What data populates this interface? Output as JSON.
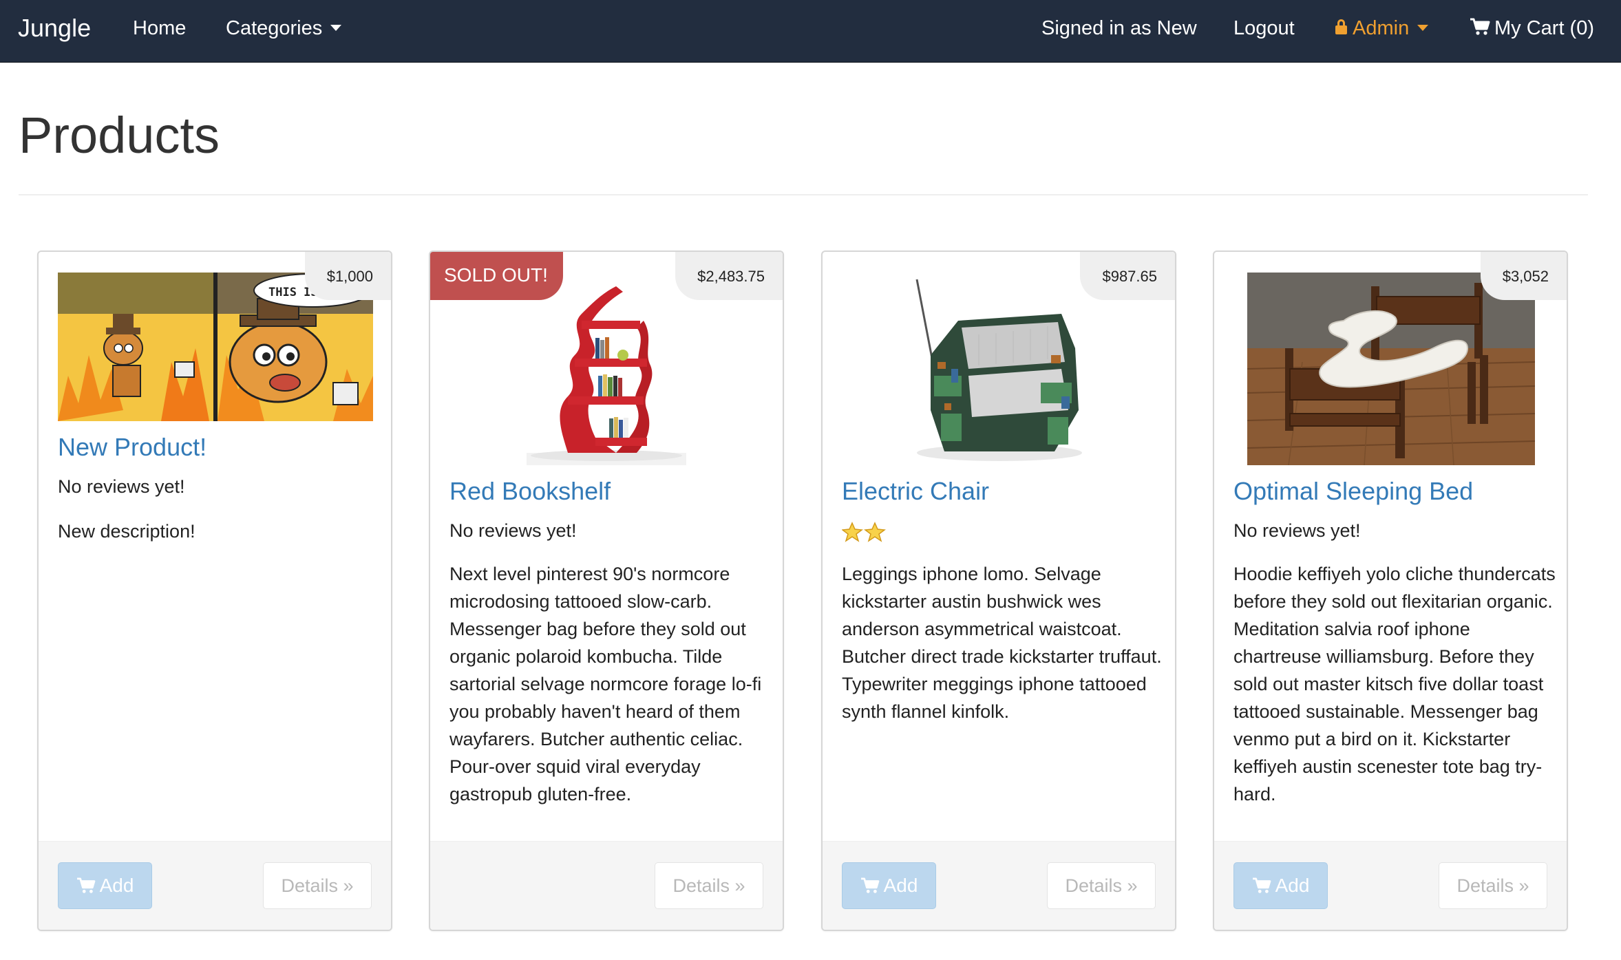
{
  "navbar": {
    "brand": "Jungle",
    "home": "Home",
    "categories": "Categories",
    "signed_in": "Signed in as New",
    "logout": "Logout",
    "admin": "Admin",
    "cart": "My Cart (0)"
  },
  "page": {
    "title": "Products"
  },
  "colors": {
    "navbar_bg": "#222d3f",
    "link_blue": "#337ab7",
    "admin_orange": "#f0a030",
    "sold_out_red": "#c0504f",
    "add_button_disabled": "#bcd7ee"
  },
  "products": [
    {
      "name": "New Product!",
      "price": "$1,000",
      "reviews": "No reviews yet!",
      "description": "New description!",
      "sold_out": "",
      "add_label": "Add",
      "details_label": "Details »",
      "image": "this-is-fine-meme",
      "image_caption": "THIS IS F"
    },
    {
      "name": "Red Bookshelf",
      "price": "$2,483.75",
      "reviews": "No reviews yet!",
      "description": "Next level pinterest 90's normcore microdosing tattooed slow-carb. Messenger bag before they sold out organic polaroid kombucha. Tilde sartorial selvage normcore forage lo-fi you probably haven't heard of them wayfarers. Butcher authentic celiac. Pour-over squid viral everyday gastropub gluten-free.",
      "sold_out": "SOLD OUT!",
      "details_label": "Details »",
      "image": "red-bookshelf"
    },
    {
      "name": "Electric Chair",
      "price": "$987.65",
      "rating": 2,
      "stars": "⭐⭐",
      "description": "Leggings iphone lomo. Selvage kickstarter austin bushwick wes anderson asymmetrical waistcoat. Butcher direct trade kickstarter truffaut. Typewriter meggings iphone tattooed synth flannel kinfolk.",
      "sold_out": "",
      "add_label": "Add",
      "details_label": "Details »",
      "image": "circuit-board-armchair"
    },
    {
      "name": "Optimal Sleeping Bed",
      "price": "$3,052",
      "reviews": "No reviews yet!",
      "description": "Hoodie keffiyeh yolo cliche thundercats before they sold out flexitarian organic. Meditation salvia roof iphone chartreuse williamsburg. Before they sold out master kitsch five dollar toast tattooed sustainable. Messenger bag venmo put a bird on it. Kickstarter keffiyeh austin scenester tote bag try-hard.",
      "sold_out": "",
      "add_label": "Add",
      "details_label": "Details »",
      "image": "wooden-bed-zigzag-mattress"
    }
  ]
}
